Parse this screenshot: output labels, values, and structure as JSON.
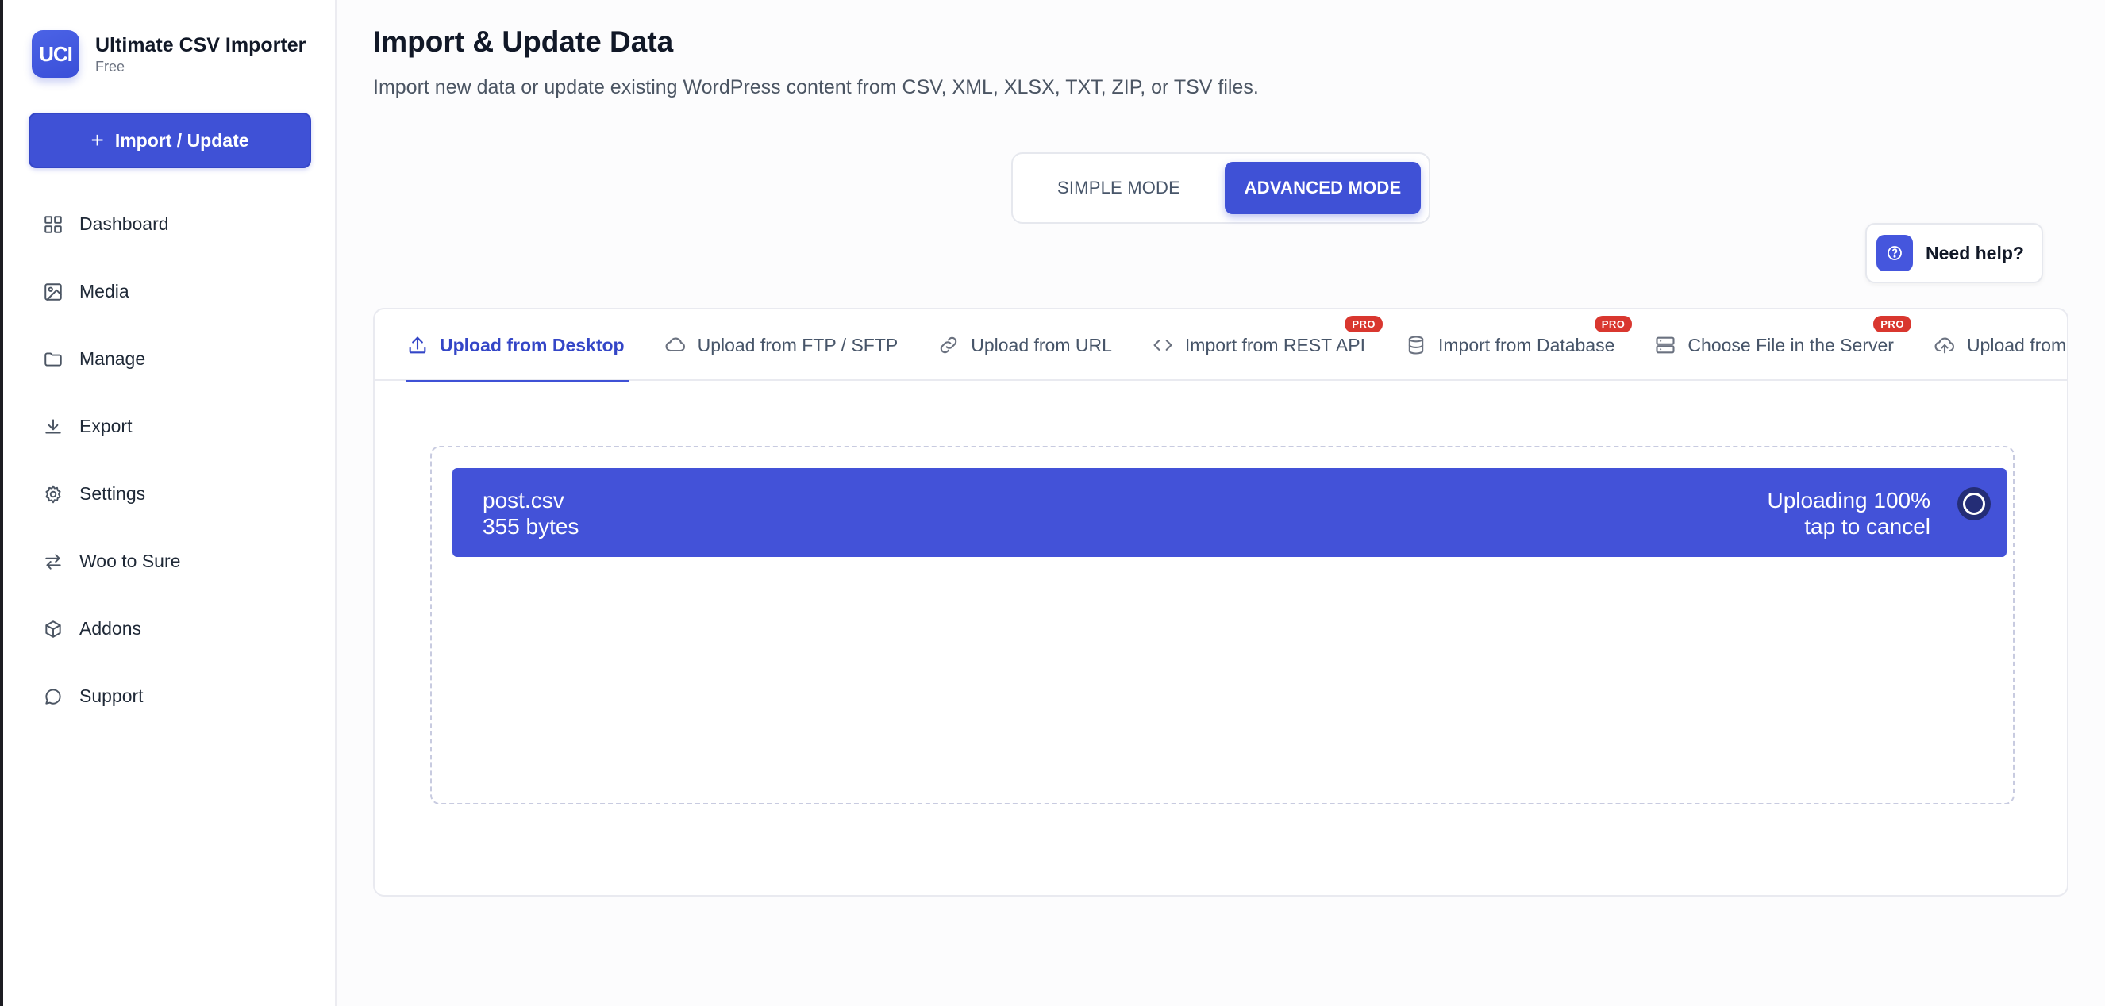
{
  "brand": {
    "logo_text": "UCI",
    "name": "Ultimate CSV Importer",
    "tier": "Free"
  },
  "sidebar": {
    "primary_button": {
      "icon": "plus-icon",
      "label": "Import / Update"
    },
    "items": [
      {
        "label": "Dashboard",
        "icon": "grid-icon"
      },
      {
        "label": "Media",
        "icon": "image-icon"
      },
      {
        "label": "Manage",
        "icon": "folder-icon"
      },
      {
        "label": "Export",
        "icon": "download-icon"
      },
      {
        "label": "Settings",
        "icon": "gear-icon"
      },
      {
        "label": "Woo to Sure",
        "icon": "arrows-swap-icon"
      },
      {
        "label": "Addons",
        "icon": "box-icon"
      },
      {
        "label": "Support",
        "icon": "chat-bubble-icon"
      }
    ]
  },
  "header": {
    "title": "Import & Update Data",
    "subtitle": "Import new data or update existing WordPress content from CSV, XML, XLSX, TXT, ZIP, or TSV files."
  },
  "mode_toggle": {
    "simple": "SIMPLE MODE",
    "advanced": "ADVANCED MODE",
    "selected": "advanced"
  },
  "help": {
    "label": "Need help?",
    "icon": "question-circle-icon"
  },
  "tabs": [
    {
      "label": "Upload from Desktop",
      "icon": "upload-icon",
      "active": true,
      "pro": ""
    },
    {
      "label": "Upload from FTP / SFTP",
      "icon": "cloud-icon",
      "active": false,
      "pro": ""
    },
    {
      "label": "Upload from URL",
      "icon": "link-icon",
      "active": false,
      "pro": ""
    },
    {
      "label": "Import from REST API",
      "icon": "code-icon",
      "active": false,
      "pro": "PRO"
    },
    {
      "label": "Import from Database",
      "icon": "database-icon",
      "active": false,
      "pro": "PRO"
    },
    {
      "label": "Choose File in the Server",
      "icon": "server-icon",
      "active": false,
      "pro": "PRO"
    },
    {
      "label": "Upload from Exte",
      "icon": "cloud-upload-icon",
      "active": false,
      "pro": ""
    }
  ],
  "upload": {
    "file_name": "post.csv",
    "file_size": "355 bytes",
    "status": "Uploading 100%",
    "action": "tap to cancel",
    "progress": 1.0
  },
  "colors": {
    "accent": "#3f51d6",
    "pro_badge": "#d9372f",
    "file_item_bg": "#4352d8"
  }
}
